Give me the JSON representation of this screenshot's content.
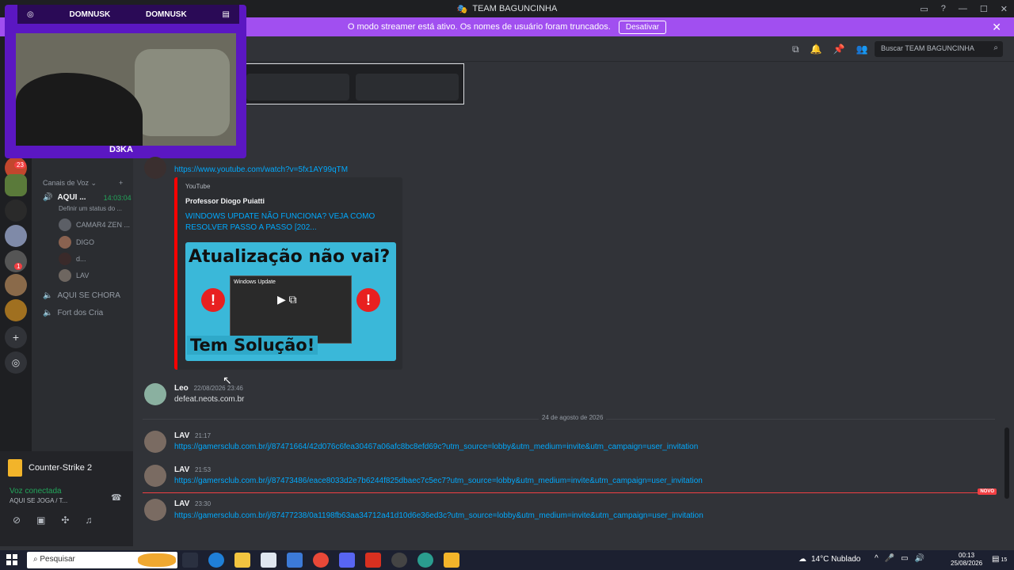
{
  "window": {
    "title": "TEAM BAGUNCINHA",
    "controls": [
      "—",
      "☐",
      "✕"
    ]
  },
  "streamer_banner": {
    "text": "O modo streamer está ativo. Os nomes de usuário foram truncados.",
    "button": "Desativar"
  },
  "header": {
    "search_placeholder": "Buscar TEAM BAGUNCINHA"
  },
  "webcam_overlay": {
    "handle_left": "DOMNUSK",
    "handle_right": "DOMNUSK",
    "name": "D3KA"
  },
  "sidebar": {
    "guild_badges": [
      "23",
      "1"
    ],
    "voice_category": "Canais de Voz",
    "voice_channels": [
      {
        "name": "AQUI ...",
        "timer": "14:03:04",
        "status": "Definir um status do ..."
      },
      {
        "name": "AQUI SE CHORA"
      },
      {
        "name": "Fort dos Cria"
      }
    ],
    "voice_users": [
      "CAMAR4 ZEN ...",
      "DIGO",
      "d...",
      "LAV"
    ]
  },
  "user_panel": {
    "game": "Counter-Strike 2",
    "voice_status": "Voz conectada",
    "voice_channel": "AQUI SE JOGA / T..."
  },
  "messages": [
    {
      "link": "https://www.youtube.com/watch?v=5fx1AY99qTM",
      "embed": {
        "provider": "YouTube",
        "author": "Professor Diogo Puiatti",
        "title": "WINDOWS UPDATE NÃO FUNCIONA? VEJA COMO RESOLVER PASSO A PASSO [202...",
        "thumb_top": "Atualização não vai?",
        "thumb_window": "Windows Update",
        "thumb_bottom": "Tem Solução!"
      }
    },
    {
      "author": "Leo",
      "time": "22/08/2026 23:46",
      "text": "defeat.neots.com.br"
    },
    {
      "author": "LAV",
      "time": "21:17",
      "link": "https://gamersclub.com.br/j/87471664/42d076c6fea30467a06afc8bc8efd69c?utm_source=lobby&utm_medium=invite&utm_campaign=user_invitation"
    },
    {
      "author": "LAV",
      "time": "21:53",
      "link": "https://gamersclub.com.br/j/87473486/eace8033d2e7b6244f825dbaec7c5ec7?utm_source=lobby&utm_medium=invite&utm_campaign=user_invitation"
    },
    {
      "author": "LAV",
      "time": "23:30",
      "link": "https://gamersclub.com.br/j/87477238/0a1198fb63aa34712a41d10d6e36ed3c?utm_source=lobby&utm_medium=invite&utm_campaign=user_invitation"
    }
  ],
  "date_divider": "24 de agosto de 2026",
  "new_label": "NOVO",
  "taskbar": {
    "search": "Pesquisar",
    "weather": "14°C  Nublado",
    "time": "00:13",
    "date": "25/08/2026",
    "notification_count": "15"
  }
}
